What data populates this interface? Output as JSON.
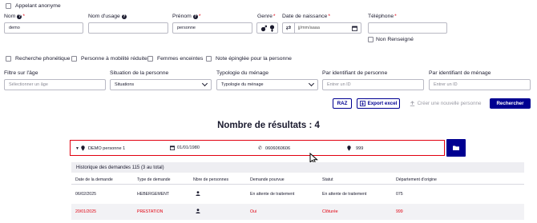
{
  "anonymous_caller": {
    "label": "Appelant anonyme"
  },
  "fields": {
    "nom": {
      "label": "Nom",
      "value": "demo"
    },
    "nom_usage": {
      "label": "Nom d'usage",
      "value": ""
    },
    "prenom": {
      "label": "Prénom",
      "value": "personne"
    },
    "genre": {
      "label": "Genre"
    },
    "date_naissance": {
      "label": "Date de naissance",
      "placeholder": "jj/mm/aaaa"
    },
    "telephone": {
      "label": "Téléphone",
      "value": ""
    },
    "non_renseigne": {
      "label": "Non Renseigné"
    }
  },
  "options": [
    {
      "label": "Recherche phonétique"
    },
    {
      "label": "Personne à mobilité réduite"
    },
    {
      "label": "Femmes enceintes"
    },
    {
      "label": "Note épinglée pour la personne"
    }
  ],
  "filters": {
    "age": {
      "label": "Filtre sur l'âge",
      "placeholder": "Sélectionner un âge"
    },
    "situation": {
      "label": "Situation de la personne",
      "value": "Situations"
    },
    "typologie": {
      "label": "Typologie du ménage",
      "value": "Typologie du ménage"
    },
    "id_personne": {
      "label": "Par identifiant de personne",
      "placeholder": "Entrer un ID"
    },
    "id_menage": {
      "label": "Par identifiant de ménage",
      "placeholder": "Entrer un ID"
    }
  },
  "actions": {
    "raz": "RAZ",
    "export": "Export excel",
    "create": "Créer une nouvelle personne",
    "search": "Rechercher"
  },
  "results": {
    "title": "Nombre de résultats : 4",
    "person": {
      "name": "DEMO personne 1",
      "birthdate": "01/01/1980",
      "phone": "0606060606",
      "location": "999"
    }
  },
  "history": {
    "title": "Historique des demandes 115 (3 au total)",
    "columns": [
      "Date de la demande",
      "Type de demande",
      "Nbre de personnes",
      "Demande pourvue",
      "Statut",
      "Département d'origine"
    ],
    "rows": [
      {
        "date": "06/02/2025",
        "type": "HEBERGEMENT",
        "pourvue": "En attente de traitement",
        "statut": "En attente de traitement",
        "dept": "075"
      },
      {
        "date": "20/01/2025",
        "type": "PRESTATION",
        "pourvue": "Oui",
        "statut": "Clôturée",
        "dept": "999"
      }
    ]
  },
  "colors": {
    "primary": "#000091",
    "error": "#e1000f",
    "highlight_border": "#e1000f"
  }
}
